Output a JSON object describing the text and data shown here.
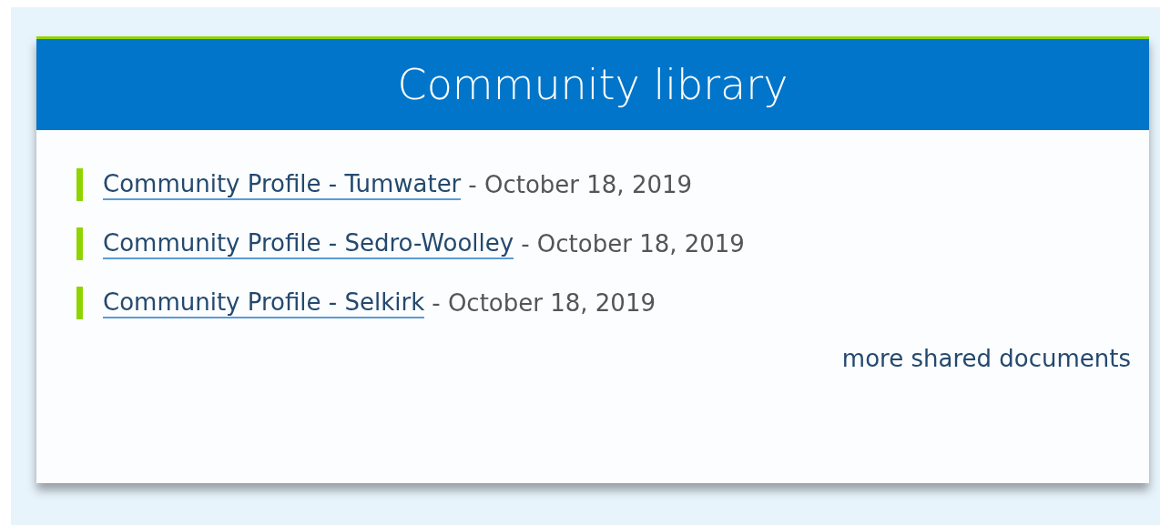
{
  "panel": {
    "title": "Community library",
    "documents": [
      {
        "title": "Community Profile - Tumwater",
        "date": "- October 18, 2019"
      },
      {
        "title": "Community Profile - Sedro-Woolley",
        "date": "- October 18, 2019"
      },
      {
        "title": "Community Profile - Selkirk",
        "date": "- October 18, 2019"
      }
    ],
    "more_link": "more shared documents"
  }
}
